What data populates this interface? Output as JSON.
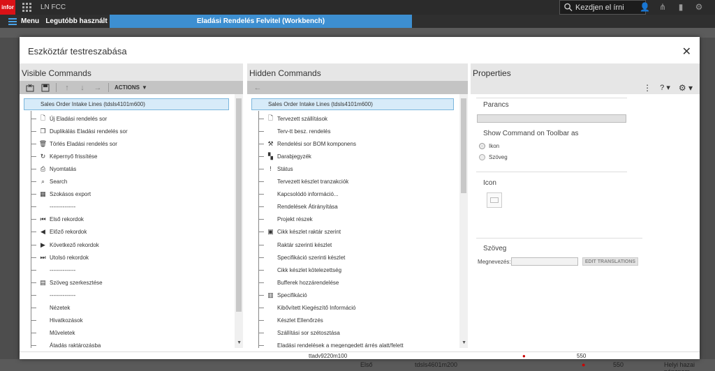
{
  "topbar": {
    "logo": "infor",
    "app_name": "LN FCC",
    "search_placeholder": "Kezdjen el írni"
  },
  "tabs": {
    "menu_label": "Menu",
    "recent_label": "Legutóbb használt",
    "active_label": "Eladási Rendelés Felvitel (Workbench)"
  },
  "modal": {
    "title": "Eszköztár testreszabása",
    "close": "✕"
  },
  "visible": {
    "title": "Visible Commands",
    "actions_label": "ACTIONS",
    "root": "Sales Order Intake Lines (tdsls4101m600)",
    "items": [
      {
        "label": "Új Eladási rendelés sor",
        "icon": "new-doc-icon"
      },
      {
        "label": "Duplikálás Eladási rendelés sor",
        "icon": "duplicate-icon"
      },
      {
        "label": "Törlés Eladási rendelés sor",
        "icon": "trash-icon"
      },
      {
        "label": "Képernyő frissítése",
        "icon": "refresh-icon"
      },
      {
        "label": "Nyomtatás",
        "icon": "print-icon"
      },
      {
        "label": "Search",
        "icon": "search-icon"
      },
      {
        "label": "Szokásos export",
        "icon": "export-icon"
      },
      {
        "label": "--------------",
        "icon": ""
      },
      {
        "label": "Első rekordok",
        "icon": "first-icon"
      },
      {
        "label": "Előző rekordok",
        "icon": "prev-icon"
      },
      {
        "label": "Következő rekordok",
        "icon": "next-icon"
      },
      {
        "label": "Utolsó rekordok",
        "icon": "last-icon"
      },
      {
        "label": "--------------",
        "icon": ""
      },
      {
        "label": "Szöveg szerkesztése",
        "icon": "calendar-icon"
      },
      {
        "label": "--------------",
        "icon": ""
      },
      {
        "label": "Nézetek",
        "icon": ""
      },
      {
        "label": "Hivatkozások",
        "icon": ""
      },
      {
        "label": "Műveletek",
        "icon": ""
      },
      {
        "label": "Átadás raktározásba",
        "icon": ""
      }
    ]
  },
  "hidden": {
    "title": "Hidden Commands",
    "root": "Sales Order Intake Lines (tdsls4101m600)",
    "items": [
      {
        "label": "Tervezett szállítások",
        "icon": "truck-doc-icon"
      },
      {
        "label": "Terv-tt besz. rendelés",
        "icon": ""
      },
      {
        "label": "Rendelési sor BOM komponens",
        "icon": "bom-icon"
      },
      {
        "label": "Darabjegyzék",
        "icon": "parts-icon"
      },
      {
        "label": "Státus",
        "icon": "status-icon"
      },
      {
        "label": "Tervezett készlet tranzakciók",
        "icon": ""
      },
      {
        "label": "Kapcsolódó információ...",
        "icon": ""
      },
      {
        "label": "Rendelések Átirányítása",
        "icon": ""
      },
      {
        "label": "Projekt részek",
        "icon": ""
      },
      {
        "label": "Cikk készlet raktár szerint",
        "icon": "stock-icon"
      },
      {
        "label": "Raktár szerinti készlet",
        "icon": ""
      },
      {
        "label": "Specifikáció szerinti készlet",
        "icon": ""
      },
      {
        "label": "Cikk készlet kötelezettség",
        "icon": ""
      },
      {
        "label": "Bufferek hozzárendelése",
        "icon": ""
      },
      {
        "label": "Specifikáció",
        "icon": "spec-icon"
      },
      {
        "label": "Kibővített Kiegészítő Információ",
        "icon": ""
      },
      {
        "label": "Készlet Ellenőrzés",
        "icon": ""
      },
      {
        "label": "Szállítási sor szétosztása",
        "icon": ""
      },
      {
        "label": "Eladási rendelések a megengedett árrés alatt/felett",
        "icon": ""
      }
    ]
  },
  "properties": {
    "title": "Properties",
    "command_head": "Parancs",
    "show_as_head": "Show Command on Toolbar as",
    "radio_icon": "Ikon",
    "radio_text": "Szöveg",
    "icon_head": "Icon",
    "text_head": "Szöveg",
    "name_label": "Megnevezés:",
    "edit_translations": "EDIT TRANSLATIONS"
  },
  "footer": {
    "modal_code": "ttadv9220m100",
    "modal_num": "550",
    "bg_first": "Első",
    "bg_code": "tdsls4601m200",
    "bg_num": "550",
    "bg_currency": "Helyi hazai pénznem"
  }
}
